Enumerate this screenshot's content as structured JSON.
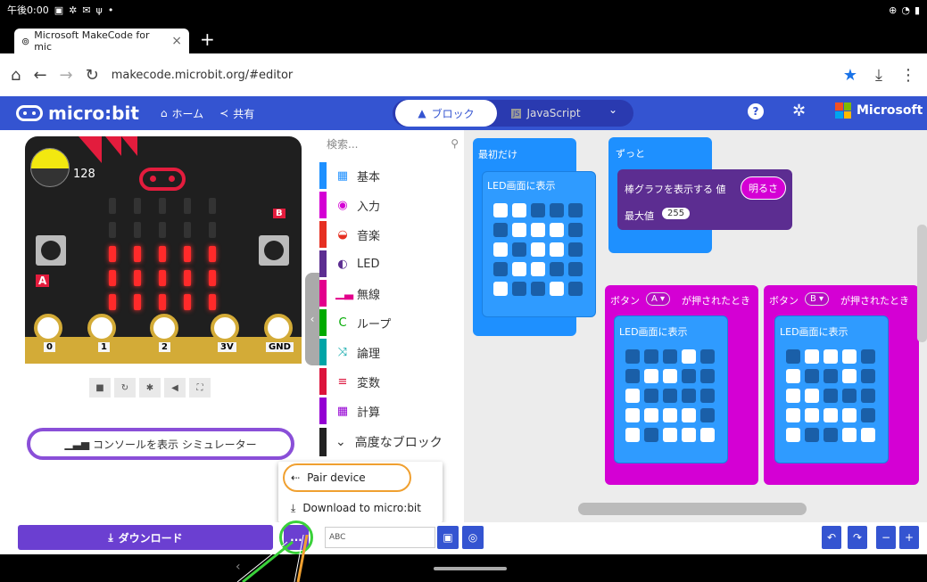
{
  "status": {
    "time": "午後0:00"
  },
  "browser": {
    "tab_title": "Microsoft MakeCode for mic",
    "url": "makecode.microbit.org/#editor"
  },
  "header": {
    "logo": "micro:bit",
    "home": "ホーム",
    "share": "共有",
    "blocks": "ブロック",
    "javascript": "JavaScript",
    "microsoft": "Microsoft"
  },
  "simulator": {
    "light_level": "128",
    "pins": [
      "0",
      "1",
      "2",
      "3V",
      "GND"
    ],
    "button_a": "A",
    "button_b": "B",
    "console_label": "コンソールを表示 シミュレーター"
  },
  "toolbox": {
    "search_placeholder": "検索...",
    "categories": [
      {
        "label": "基本",
        "color": "#1e90ff"
      },
      {
        "label": "入力",
        "color": "#d400d4"
      },
      {
        "label": "音楽",
        "color": "#e63022"
      },
      {
        "label": "LED",
        "color": "#5c2d91"
      },
      {
        "label": "無線",
        "color": "#e3008c"
      },
      {
        "label": "ループ",
        "color": "#00aa00"
      },
      {
        "label": "論理",
        "color": "#00a4a6"
      },
      {
        "label": "変数",
        "color": "#dc143c"
      },
      {
        "label": "計算",
        "color": "#9400d3"
      }
    ],
    "advanced": "高度なブロック"
  },
  "workspace": {
    "on_start": "最初だけ",
    "show_leds": "LED画面に表示",
    "forever": "ずっと",
    "plot_bar_graph": "棒グラフを表示する 値",
    "brightness": "明るさ",
    "max_value": "最大値",
    "max_number": "255",
    "on_button_pressed": "が押されたとき",
    "button_label": "ボタン",
    "button_a": "A ▾",
    "button_b": "B ▾"
  },
  "popup": {
    "pair_device": "Pair device",
    "download_to": "Download to micro:bit"
  },
  "bottom": {
    "download": "ダウンロード",
    "more": "...",
    "project_name": "ABC"
  }
}
